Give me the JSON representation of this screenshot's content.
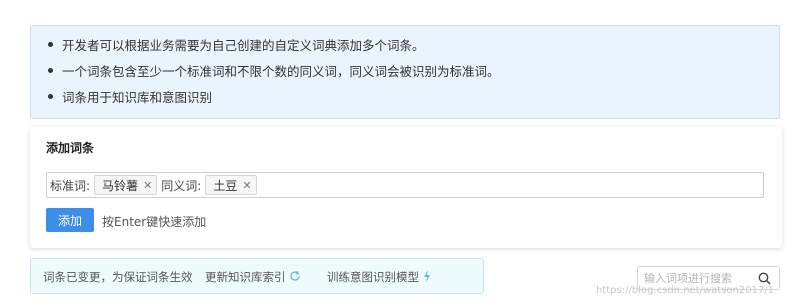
{
  "info": {
    "items": [
      "开发者可以根据业务需要为自己创建的自定义词典添加多个词条。",
      "一个词条包含至少一个标准词和不限个数的同义词，同义词会被识别为标准词。",
      "词条用于知识库和意图识别"
    ]
  },
  "card": {
    "title": "添加词条",
    "standard_label": "标准词:",
    "standard_tags": [
      "马铃薯"
    ],
    "synonym_label": "同义词:",
    "synonym_tags": [
      "土豆"
    ],
    "tag_remove_icon": "close-icon",
    "add_button": "添加",
    "hint": "按Enter键快速添加"
  },
  "status": {
    "message": "词条已变更，为保证词条生效",
    "update_index": "更新知识库索引",
    "update_index_icon": "refresh-icon",
    "train_model": "训练意图识别模型",
    "train_model_icon": "lightning-icon"
  },
  "search": {
    "placeholder": "输入词项进行搜索",
    "icon": "search-icon"
  },
  "watermark": "https://blog.csdn.net/watson2017/1",
  "colors": {
    "primary": "#3d8ee8",
    "info_bg": "#eaf4ff",
    "status_bg": "#eefbfd"
  }
}
